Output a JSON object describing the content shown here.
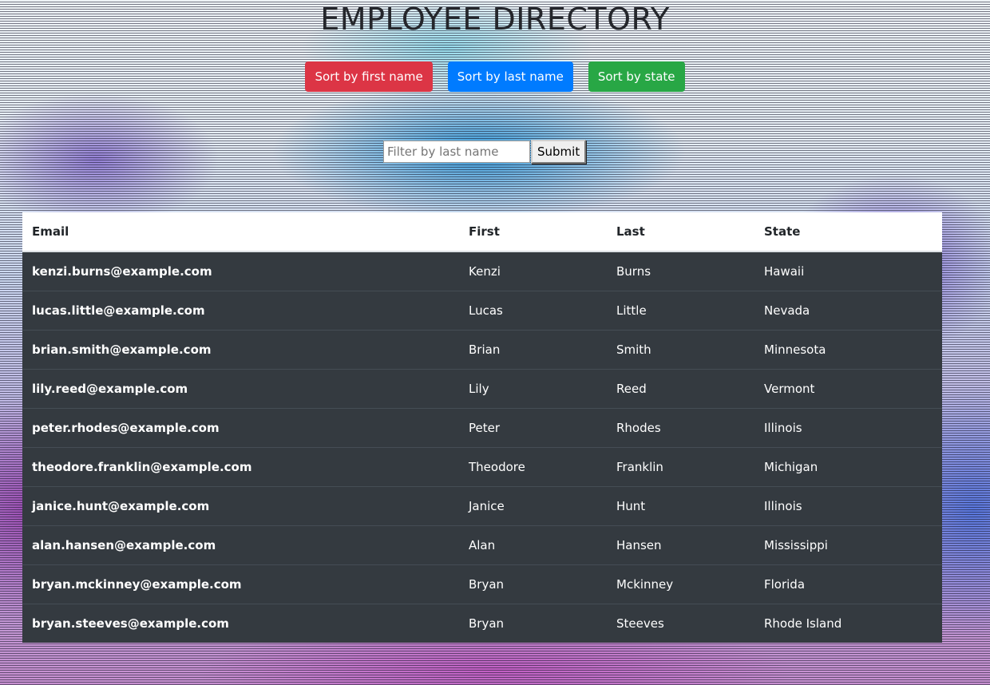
{
  "header": {
    "title": "EMPLOYEE DIRECTORY"
  },
  "sort_buttons": {
    "first_label": "Sort by first name",
    "last_label": "Sort by last name",
    "state_label": "Sort by state"
  },
  "filter": {
    "placeholder": "Filter by last name",
    "value": "",
    "submit_label": "Submit"
  },
  "table": {
    "headers": [
      "Email",
      "First",
      "Last",
      "State"
    ],
    "rows": [
      {
        "email": "kenzi.burns@example.com",
        "first": "Kenzi",
        "last": "Burns",
        "state": "Hawaii"
      },
      {
        "email": "lucas.little@example.com",
        "first": "Lucas",
        "last": "Little",
        "state": "Nevada"
      },
      {
        "email": "brian.smith@example.com",
        "first": "Brian",
        "last": "Smith",
        "state": "Minnesota"
      },
      {
        "email": "lily.reed@example.com",
        "first": "Lily",
        "last": "Reed",
        "state": "Vermont"
      },
      {
        "email": "peter.rhodes@example.com",
        "first": "Peter",
        "last": "Rhodes",
        "state": "Illinois"
      },
      {
        "email": "theodore.franklin@example.com",
        "first": "Theodore",
        "last": "Franklin",
        "state": "Michigan"
      },
      {
        "email": "janice.hunt@example.com",
        "first": "Janice",
        "last": "Hunt",
        "state": "Illinois"
      },
      {
        "email": "alan.hansen@example.com",
        "first": "Alan",
        "last": "Hansen",
        "state": "Mississippi"
      },
      {
        "email": "bryan.mckinney@example.com",
        "first": "Bryan",
        "last": "Mckinney",
        "state": "Florida"
      },
      {
        "email": "bryan.steeves@example.com",
        "first": "Bryan",
        "last": "Steeves",
        "state": "Rhode Island"
      }
    ]
  },
  "colors": {
    "sort_first": "#dc3545",
    "sort_last": "#007bff",
    "sort_state": "#28a745",
    "table_body": "#343a40",
    "table_header": "#ffffff"
  }
}
